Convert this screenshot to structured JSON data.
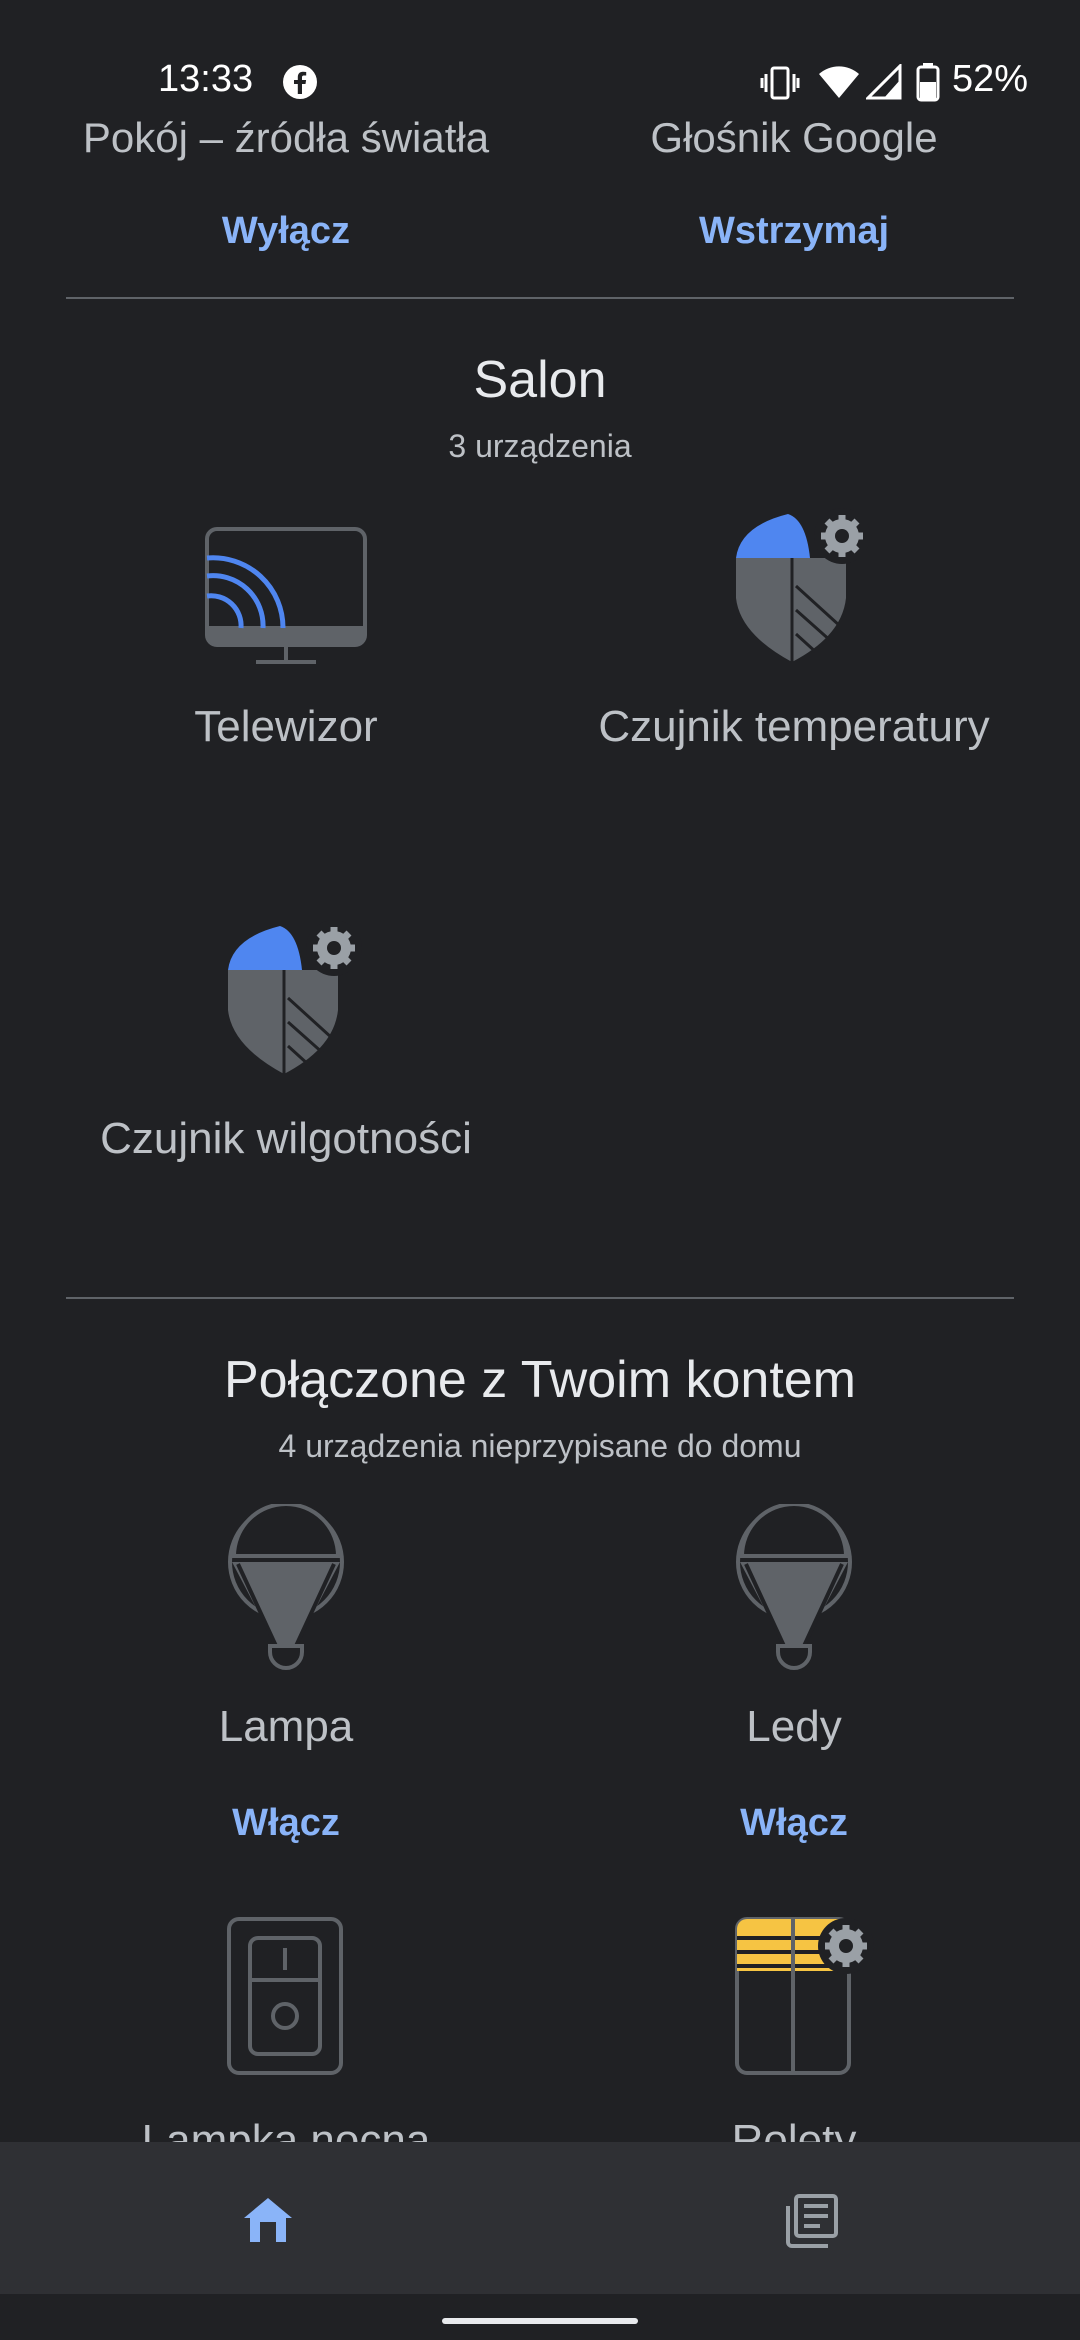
{
  "status_bar": {
    "time": "13:33",
    "battery_pct": "52%",
    "icons": [
      "facebook-icon",
      "vibrate-icon",
      "wifi-icon",
      "signal-icon",
      "battery-icon"
    ]
  },
  "top_row": {
    "left": {
      "name": "Pokój – źródła światła",
      "action": "Wyłącz"
    },
    "right": {
      "name": "Głośnik Google",
      "action": "Wstrzymaj"
    }
  },
  "salon": {
    "title": "Salon",
    "subtitle": "3 urządzenia",
    "devices": [
      {
        "label": "Telewizor",
        "icon": "tv-cast-icon"
      },
      {
        "label": "Czujnik temperatury",
        "icon": "sensor-shield-icon"
      },
      {
        "label": "Czujnik wilgotności",
        "icon": "sensor-shield-icon"
      }
    ]
  },
  "linked": {
    "title": "Połączone z Twoim kontem",
    "subtitle": "4 urządzenia nieprzypisane do domu",
    "devices": [
      {
        "label": "Lampa",
        "action": "Włącz",
        "icon": "bulb-icon"
      },
      {
        "label": "Ledy",
        "action": "Włącz",
        "icon": "bulb-icon"
      },
      {
        "label": "Lampka nocna",
        "icon": "switch-icon"
      },
      {
        "label": "Rolety",
        "icon": "blinds-icon"
      }
    ]
  },
  "nav": {
    "items": [
      "home-icon",
      "feed-icon"
    ]
  },
  "colors": {
    "background": "#202124",
    "accent": "#8ab4f8",
    "icon_blue": "#4f86f0",
    "icon_gray": "#5f6368",
    "blinds_yellow": "#f6c443"
  }
}
